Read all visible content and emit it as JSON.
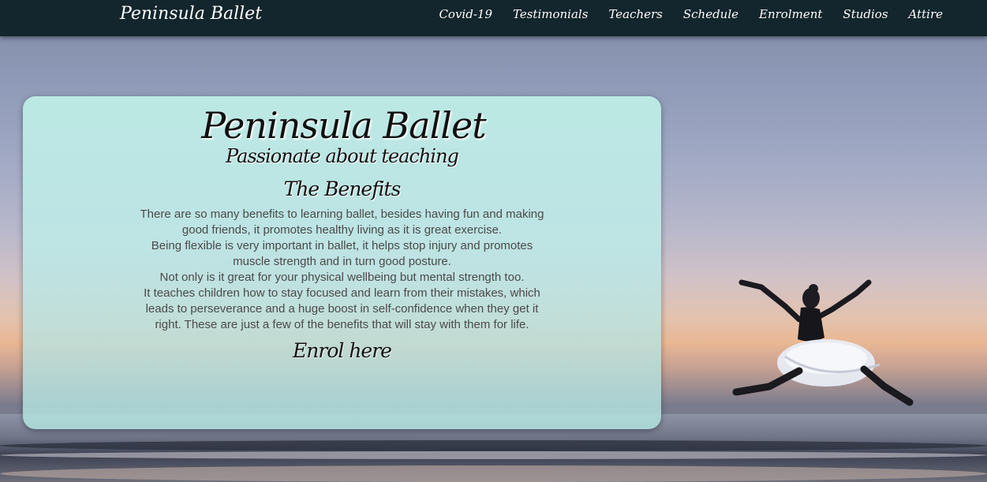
{
  "header": {
    "brand": "Peninsula Ballet",
    "nav": [
      {
        "label": "Covid-19"
      },
      {
        "label": "Testimonials"
      },
      {
        "label": "Teachers"
      },
      {
        "label": "Schedule"
      },
      {
        "label": "Enrolment"
      },
      {
        "label": "Studios"
      },
      {
        "label": "Attire"
      }
    ]
  },
  "hero": {
    "title": "Peninsula Ballet",
    "subtitle": "Passionate about teaching",
    "section_heading": "The Benefits",
    "paragraphs": [
      "There are so many benefits to learning ballet, besides having fun and making good friends, it promotes healthy living as it is great exercise.",
      "Being flexible is very important in ballet, it helps stop injury and promotes muscle strength and in turn good posture.",
      "Not only is it great for your physical wellbeing but mental strength too.",
      "It teaches children how to stay focused and learn from their mistakes, which leads to perseverance and a huge boost in self-confidence when they get it right. These are just a few of the benefits that will stay with them for life."
    ],
    "cta": "Enrol here"
  },
  "colors": {
    "navbar": "#13252d",
    "card": "#bfece6",
    "text": "#111111",
    "body_text": "#4a4a4a"
  },
  "background": {
    "scene": "beach at sunset with a leaping ballet dancer",
    "icon": "dancer-silhouette"
  }
}
